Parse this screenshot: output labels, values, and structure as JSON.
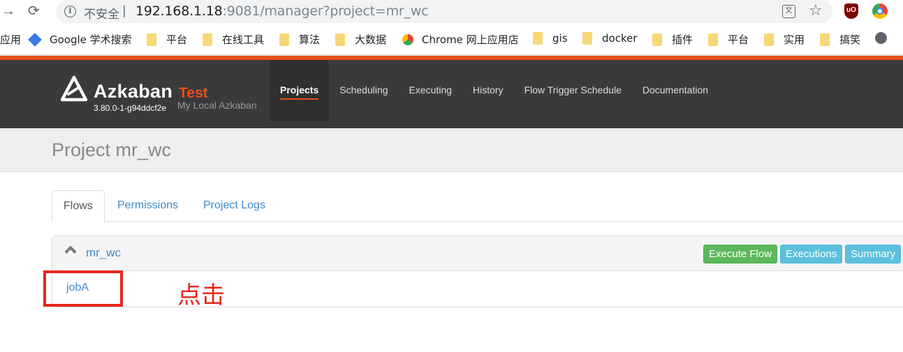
{
  "browser": {
    "insecure_label": "不安全",
    "url_host": "192.168.1.18",
    "url_rest": ":9081/manager?project=mr_wc",
    "icons": [
      "back-arrow-icon",
      "reload-icon",
      "info-icon",
      "translate-icon",
      "star-icon",
      "ublock-icon",
      "chrome-extension-icon"
    ]
  },
  "bookmarks": [
    {
      "label": "应用",
      "icon": "apps-icon"
    },
    {
      "label": "Google 学术搜索",
      "icon": "google-scholar-icon"
    },
    {
      "label": "平台",
      "icon": "folder-icon"
    },
    {
      "label": "在线工具",
      "icon": "folder-icon"
    },
    {
      "label": "算法",
      "icon": "folder-icon"
    },
    {
      "label": "大数据",
      "icon": "folder-icon"
    },
    {
      "label": "Chrome 网上应用店",
      "icon": "chrome-webstore-icon"
    },
    {
      "label": "gis",
      "icon": "folder-icon"
    },
    {
      "label": "docker",
      "icon": "folder-icon"
    },
    {
      "label": "插件",
      "icon": "folder-icon"
    },
    {
      "label": "平台",
      "icon": "folder-icon"
    },
    {
      "label": "实用",
      "icon": "folder-icon"
    },
    {
      "label": "搞笑",
      "icon": "folder-icon"
    }
  ],
  "navbar": {
    "brand": "Azkaban",
    "env": "Test",
    "version": "3.80.0-1-g94ddcf2e",
    "subtitle": "My Local Azkaban",
    "links": [
      "Projects",
      "Scheduling",
      "Executing",
      "History",
      "Flow Trigger Schedule",
      "Documentation"
    ],
    "active": "Projects",
    "colors": {
      "accent": "#ea4e1b",
      "background": "#3a3a3a"
    }
  },
  "page": {
    "title": "Project mr_wc"
  },
  "tabs": [
    "Flows",
    "Permissions",
    "Project Logs"
  ],
  "flow": {
    "name": "mr_wc",
    "buttons": {
      "execute": "Execute Flow",
      "executions": "Executions",
      "summary": "Summary"
    },
    "jobs": [
      "jobA"
    ]
  },
  "annotation": {
    "text": "点击",
    "color": "#e8251c"
  }
}
